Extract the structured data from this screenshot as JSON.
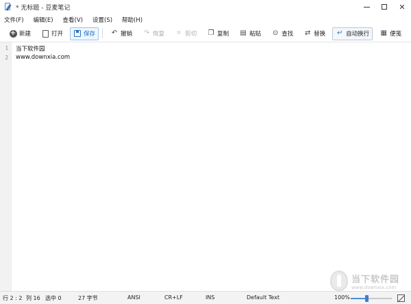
{
  "window": {
    "title": "* 无标题 - 豆麦笔记",
    "controls": {
      "minimize": "",
      "maximize": "",
      "close": "✕"
    }
  },
  "menu": [
    "文件(F)",
    "编辑(E)",
    "查看(V)",
    "设置(S)",
    "帮助(H)"
  ],
  "toolbar": {
    "new": {
      "icon": "plus-circle-icon",
      "label": "新建"
    },
    "open": {
      "icon": "document-icon",
      "label": "打开"
    },
    "save": {
      "icon": "save-icon",
      "label": "保存"
    },
    "undo": {
      "icon": "undo-icon",
      "glyph": "↶",
      "label": "撤销"
    },
    "redo": {
      "icon": "redo-icon",
      "glyph": "↷",
      "label": "恢复"
    },
    "cut": {
      "icon": "scissors-icon",
      "glyph": "⌗",
      "label": "剪切"
    },
    "copy": {
      "icon": "copy-icon",
      "glyph": "❐",
      "label": "复制"
    },
    "paste": {
      "icon": "clipboard-icon",
      "glyph": "▤",
      "label": "粘贴"
    },
    "find": {
      "icon": "search-icon",
      "glyph": "⊙",
      "label": "查找"
    },
    "replace": {
      "icon": "replace-icon",
      "glyph": "⇄",
      "label": "替换"
    },
    "wrap": {
      "icon": "word-wrap-icon",
      "glyph": "↵",
      "label": "自动换行"
    },
    "note": {
      "icon": "sticky-note-icon",
      "glyph": "▦",
      "label": "便笺"
    }
  },
  "editor": {
    "lines": [
      {
        "num": "1",
        "text": "当下软件园"
      },
      {
        "num": "2",
        "text": "www.downxia.com"
      }
    ]
  },
  "status": {
    "position": "行 2 : 2",
    "column": "列 16",
    "selected": "选中 0",
    "chars": "27 字节",
    "encoding": "ANSI",
    "line_ending": "CR+LF",
    "insert_mode": "INS",
    "style": "Default Text",
    "zoom": "100%",
    "zoom_fraction": 0.38
  },
  "colors": {
    "accent": "#2a72c6",
    "status_bg": "#f3f3f3",
    "gutter_bg": "#f2f2f2"
  },
  "watermark": {
    "name": "当下软件园",
    "url": "www.downxia.com"
  }
}
